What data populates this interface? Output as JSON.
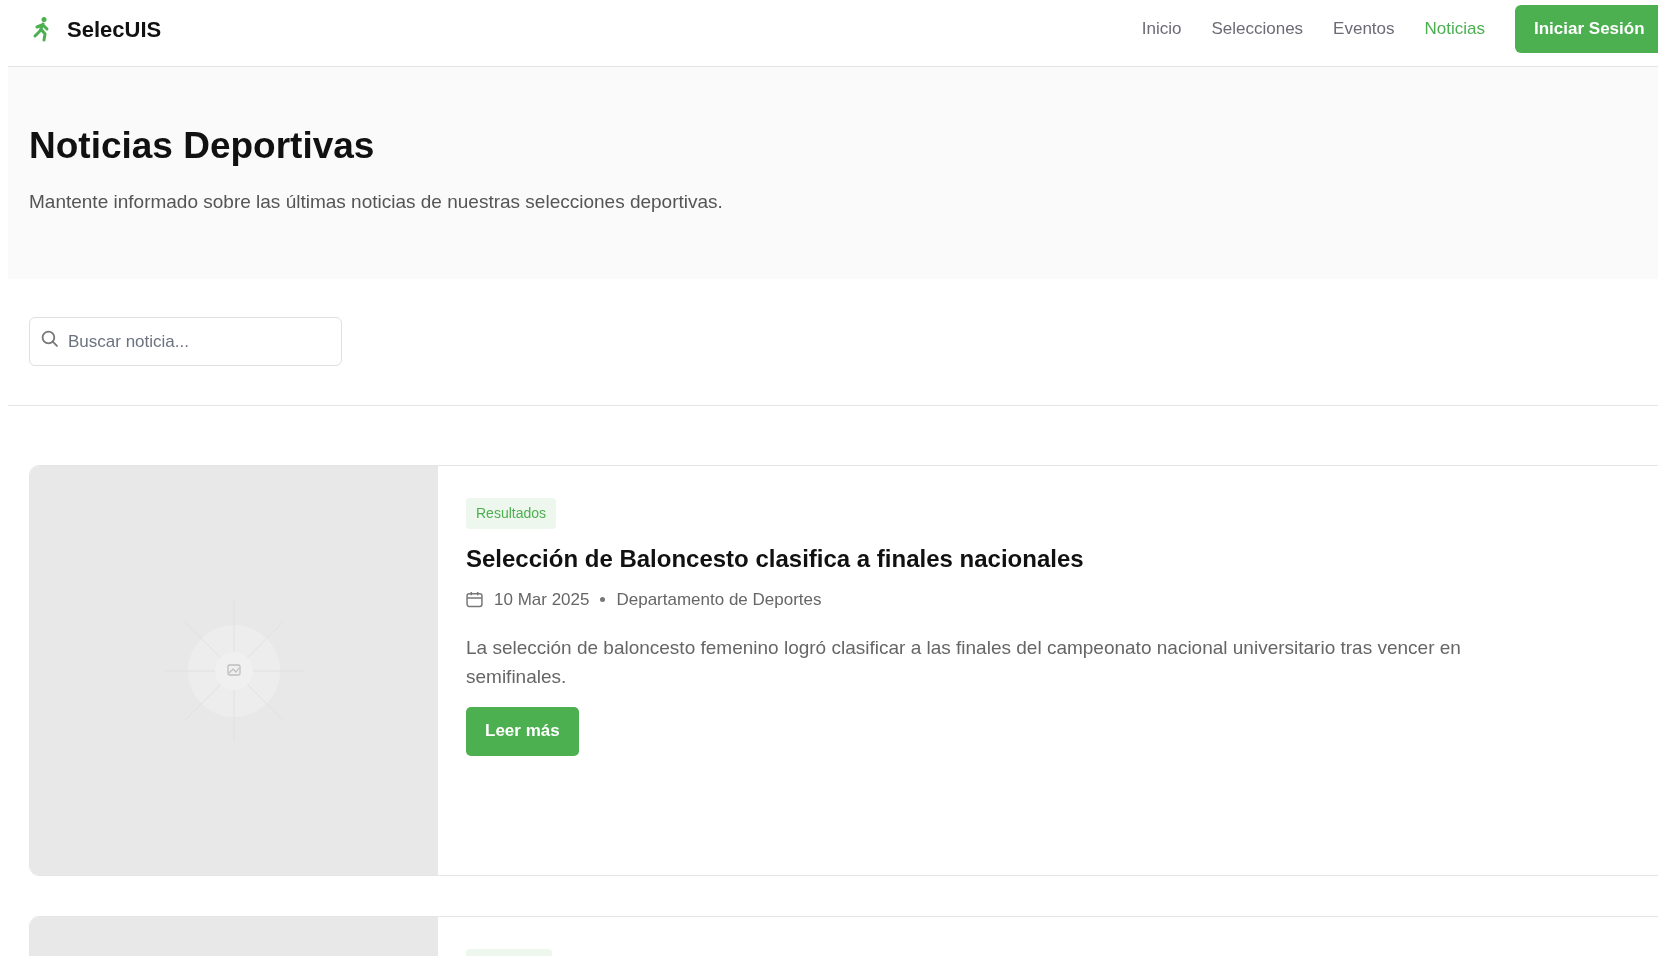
{
  "header": {
    "brand": "SelecUIS",
    "nav": [
      {
        "label": "Inicio",
        "selected": false
      },
      {
        "label": "Selecciones",
        "selected": false
      },
      {
        "label": "Eventos",
        "selected": false
      },
      {
        "label": "Noticias",
        "selected": true
      }
    ],
    "login_button": "Iniciar Sesión"
  },
  "hero": {
    "title": "Noticias Deportivas",
    "subtitle": "Mantente informado sobre las últimas noticias de nuestras selecciones deportivas."
  },
  "search": {
    "placeholder": "Buscar noticia..."
  },
  "news": [
    {
      "kind": "full",
      "tag": "Resultados",
      "title": "Selección de Baloncesto clasifica a finales nacionales",
      "date": "10 Mar 2025",
      "author": "Departamento de Deportes",
      "summary": "La selección de baloncesto femenino logró clasificar a las finales del campeonato nacional universitario tras vencer en semifinales.",
      "button": "Leer más"
    },
    {
      "kind": "cut"
    }
  ]
}
